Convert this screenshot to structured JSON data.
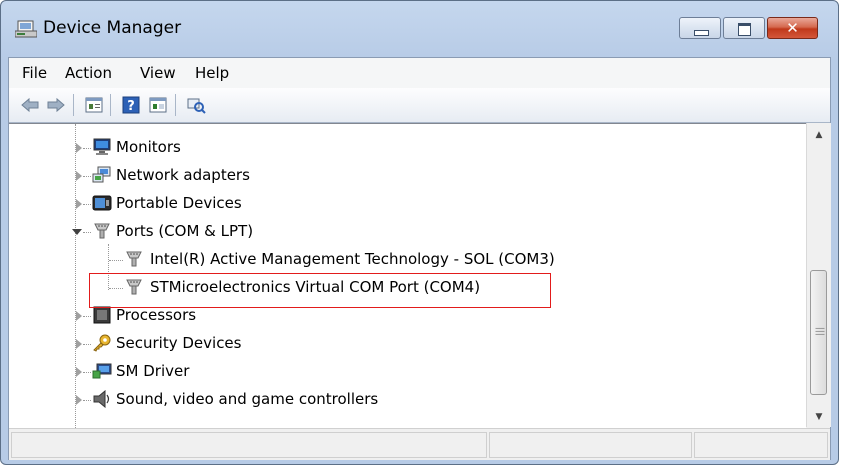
{
  "window": {
    "title": "Device Manager",
    "close_glyph": "✕",
    "icon": "device-manager-icon"
  },
  "menu": {
    "items": [
      {
        "label": "File"
      },
      {
        "label": "Action"
      },
      {
        "label": "View"
      },
      {
        "label": "Help"
      }
    ]
  },
  "toolbar": {
    "buttons": [
      "back-arrow-icon",
      "forward-arrow-icon",
      "properties-icon",
      "help-icon",
      "update-driver-icon",
      "scan-hardware-icon"
    ]
  },
  "tree": {
    "items": [
      {
        "label": "Monitors",
        "icon": "monitor-icon",
        "level": 1,
        "expanded": false
      },
      {
        "label": "Network adapters",
        "icon": "network-adapter-icon",
        "level": 1,
        "expanded": false
      },
      {
        "label": "Portable Devices",
        "icon": "portable-device-icon",
        "level": 1,
        "expanded": false
      },
      {
        "label": "Ports (COM & LPT)",
        "icon": "port-icon",
        "level": 1,
        "expanded": true
      },
      {
        "label": "Intel(R) Active Management Technology - SOL (COM3)",
        "icon": "port-icon",
        "level": 2
      },
      {
        "label": "STMicroelectronics Virtual COM Port (COM4)",
        "icon": "port-icon",
        "level": 2,
        "highlighted": true
      },
      {
        "label": "Processors",
        "icon": "processor-icon",
        "level": 1,
        "expanded": false
      },
      {
        "label": "Security Devices",
        "icon": "security-key-icon",
        "level": 1,
        "expanded": false
      },
      {
        "label": "SM Driver",
        "icon": "sm-driver-icon",
        "level": 1,
        "expanded": false
      },
      {
        "label": "Sound, video and game controllers",
        "icon": "speaker-icon",
        "level": 1,
        "expanded": false
      }
    ]
  },
  "scrollbar": {
    "up_glyph": "▲",
    "down_glyph": "▼"
  },
  "colors": {
    "highlight_border": "#e21b1b",
    "title_gradient": "#b7cbe6"
  }
}
